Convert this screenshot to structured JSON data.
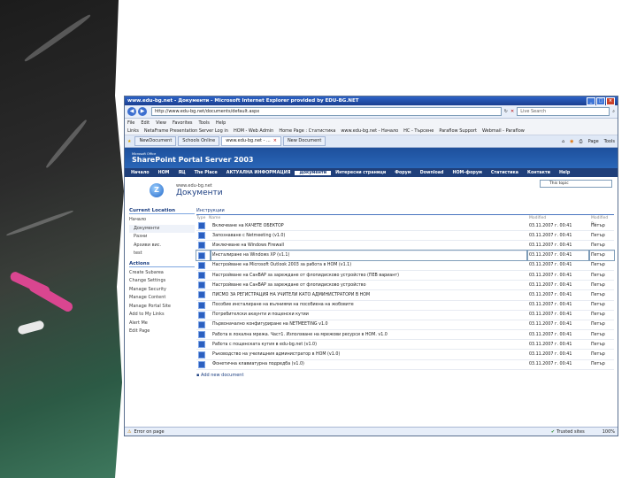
{
  "window": {
    "title": "www.edu-bg.net - Документи - Microsoft Internet Explorer provided by EDU-BG.NET"
  },
  "address": {
    "url": "http://www.edu-bg.net/documents/default.aspx",
    "search_placeholder": "Live Search"
  },
  "menu": [
    "File",
    "Edit",
    "View",
    "Favorites",
    "Tools",
    "Help"
  ],
  "links": [
    "Links",
    "NetaFrame Presentation Server Log in",
    "HOM - Web Admin",
    "Home Page : Статистика",
    "www.edu-bg.net - Начало",
    "HC - Търсене",
    "Paraflow Support",
    "Webmail - Paraflow"
  ],
  "tabs": [
    "NewDocument",
    "Schools Online",
    "www.edu-bg.net - ...",
    "New Document"
  ],
  "toolbar_tools": [
    "Page",
    "Tools"
  ],
  "banner": {
    "small": "Microsoft Office",
    "big": "SharePoint Portal Server 2003"
  },
  "topnav": [
    "Начало",
    "НОМ",
    "ЯЦ",
    "The Place",
    "АКТУАЛНА ИНФОРМАЦИЯ",
    "Документи",
    "Интересни страници",
    "Форум",
    "Download",
    "НОМ-форум",
    "Статистика",
    "Контакти",
    "Help"
  ],
  "header": {
    "site": "www.edu-bg.net",
    "title": "Документи",
    "topic": "This topic"
  },
  "leftnav": {
    "current_head": "Current Location",
    "current": [
      "Начало",
      "Документи",
      "Разни",
      "Архиви вис.",
      "test"
    ],
    "actions_head": "Actions",
    "actions": [
      "Create Subarea",
      "Change Settings",
      "Manage Security",
      "Manage Content",
      "Manage Portal Site",
      "Add to My Links",
      "Alert Me",
      "Edit Page"
    ]
  },
  "list": {
    "head": "Инструкции",
    "col_type": "Type",
    "col_name": "Name",
    "col_modified": "Modified",
    "col_by": "Modified By",
    "rows": [
      {
        "name": "Включване на КАЧЕТЕ ОБЕКТОР",
        "date": "03.11.2007 г. 00:41",
        "by": "Петър"
      },
      {
        "name": "Запознаване с Netmeeting (v1.0)",
        "date": "03.11.2007 г. 00:41",
        "by": "Петър"
      },
      {
        "name": "Изключване на Windows Firewall",
        "date": "03.11.2007 г. 00:41",
        "by": "Петър"
      },
      {
        "name": "Инсталиране на Windows XP (v1.1)",
        "date": "03.11.2007 г. 00:41",
        "by": "Петър"
      },
      {
        "name": "Настройване на Microsoft Outlook 2003 за работа в НОМ (v1.1)",
        "date": "03.11.2007 г. 00:41",
        "by": "Петър"
      },
      {
        "name": "Настройване на СанВАР за зареждане от флопидисково устройство (ПЕВ вариант)",
        "date": "03.11.2007 г. 00:41",
        "by": "Петър"
      },
      {
        "name": "Настройване на СанВАР за зареждане от флопидисково устройство",
        "date": "03.11.2007 г. 00:41",
        "by": "Петър"
      },
      {
        "name": "ПИСМО ЗА РЕГИСТРАЦИЯ НА УЧИТЕЛИ КАТО АДМИНИСТРАТОРИ В НОМ",
        "date": "03.11.2007 г. 00:41",
        "by": "Петър"
      },
      {
        "name": "Пособие инсталиране на вълниями на пособиена на жобовите",
        "date": "03.11.2007 г. 00:41",
        "by": "Петър"
      },
      {
        "name": "Потребителски акаунти и пощенски кутии",
        "date": "03.11.2007 г. 00:41",
        "by": "Петър"
      },
      {
        "name": "Първоначално конфигуриране на NETMEETING v1.0",
        "date": "03.11.2007 г. 00:41",
        "by": "Петър"
      },
      {
        "name": "Работа в локална мрежа. Част1. Използване на мрежови ресурси в НОМ. v1.0",
        "date": "03.11.2007 г. 00:41",
        "by": "Петър"
      },
      {
        "name": "Работа с пощенската кутия в edu-bg.net (v1.0)",
        "date": "03.11.2007 г. 00:41",
        "by": "Петър"
      },
      {
        "name": "Ръководство на училищния администратор в НОМ (v1.0)",
        "date": "03.11.2007 г. 00:41",
        "by": "Петър"
      },
      {
        "name": "Фонетична клавиатурна подредба (v1.0)",
        "date": "03.11.2007 г. 00:41",
        "by": "Петър"
      }
    ],
    "add_new": "Add new document"
  },
  "status": {
    "left": "Error on page",
    "zone": "Trusted sites",
    "zoom": "100%"
  }
}
